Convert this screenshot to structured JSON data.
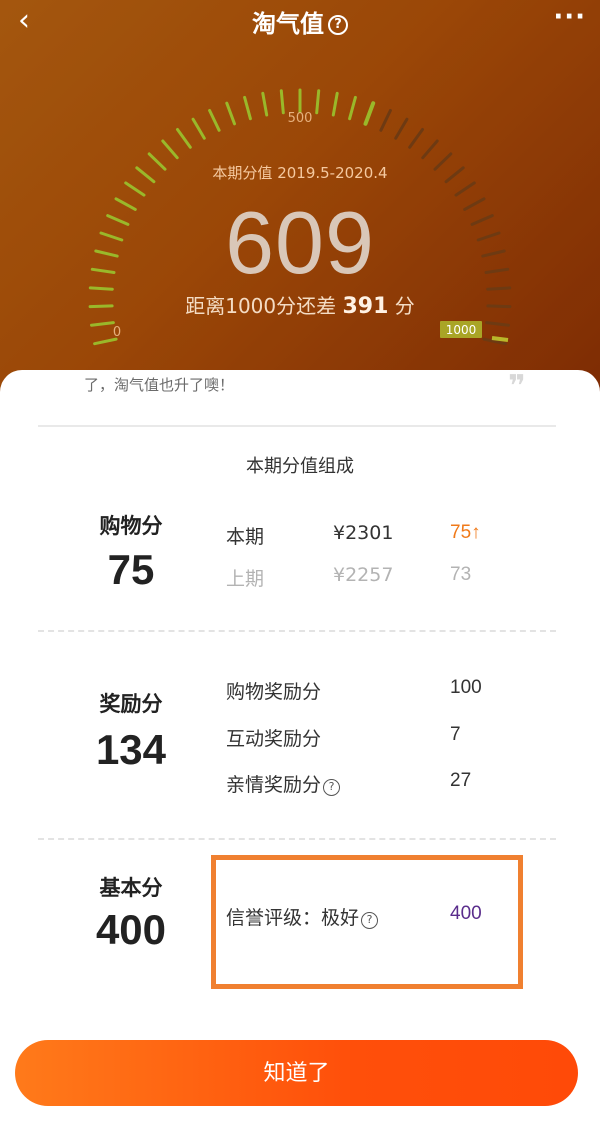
{
  "header": {
    "title": "淘气值",
    "back_icon": "chevron-left-icon",
    "help_icon": "question-circle-icon",
    "help_symbol": "?",
    "more_icon": "more-dots-icon",
    "more_symbol": "···",
    "back_symbol": "‹"
  },
  "gauge": {
    "tick_500": "500",
    "tick_0": "0",
    "tick_1000": "1000",
    "period_label": "本期分值 2019.5-2020.4",
    "score": "609",
    "diff_prefix": "距离1000分还差",
    "diff_value": "391",
    "diff_suffix": "分",
    "score_fraction": 0.609,
    "tick_color": "#9ab82a"
  },
  "notice": {
    "text": "了，淘气值也升了噢！",
    "quote_symbol": "❞"
  },
  "composition": {
    "title": "本期分值组成",
    "shopping": {
      "label": "购物分",
      "value": "75",
      "rows": [
        {
          "label": "本期",
          "amount": "¥2301",
          "score": "75↑"
        },
        {
          "label": "上期",
          "amount": "¥2257",
          "score": "73"
        }
      ]
    },
    "reward": {
      "label": "奖励分",
      "value": "134",
      "rows": [
        {
          "label": "购物奖励分",
          "score": "100"
        },
        {
          "label": "互动奖励分",
          "score": "7"
        },
        {
          "label": "亲情奖励分",
          "score": "27"
        }
      ]
    },
    "base": {
      "label": "基本分",
      "value": "400",
      "rows": [
        {
          "label": "信誉评级：极好",
          "score": "400"
        }
      ]
    },
    "question_symbol": "?"
  },
  "button": {
    "label": "知道了"
  },
  "colors": {
    "accent": "#ff5a0e",
    "highlight": "#f08030",
    "up_score": "#f07a1a",
    "credit_score": "#5a2d8c"
  }
}
